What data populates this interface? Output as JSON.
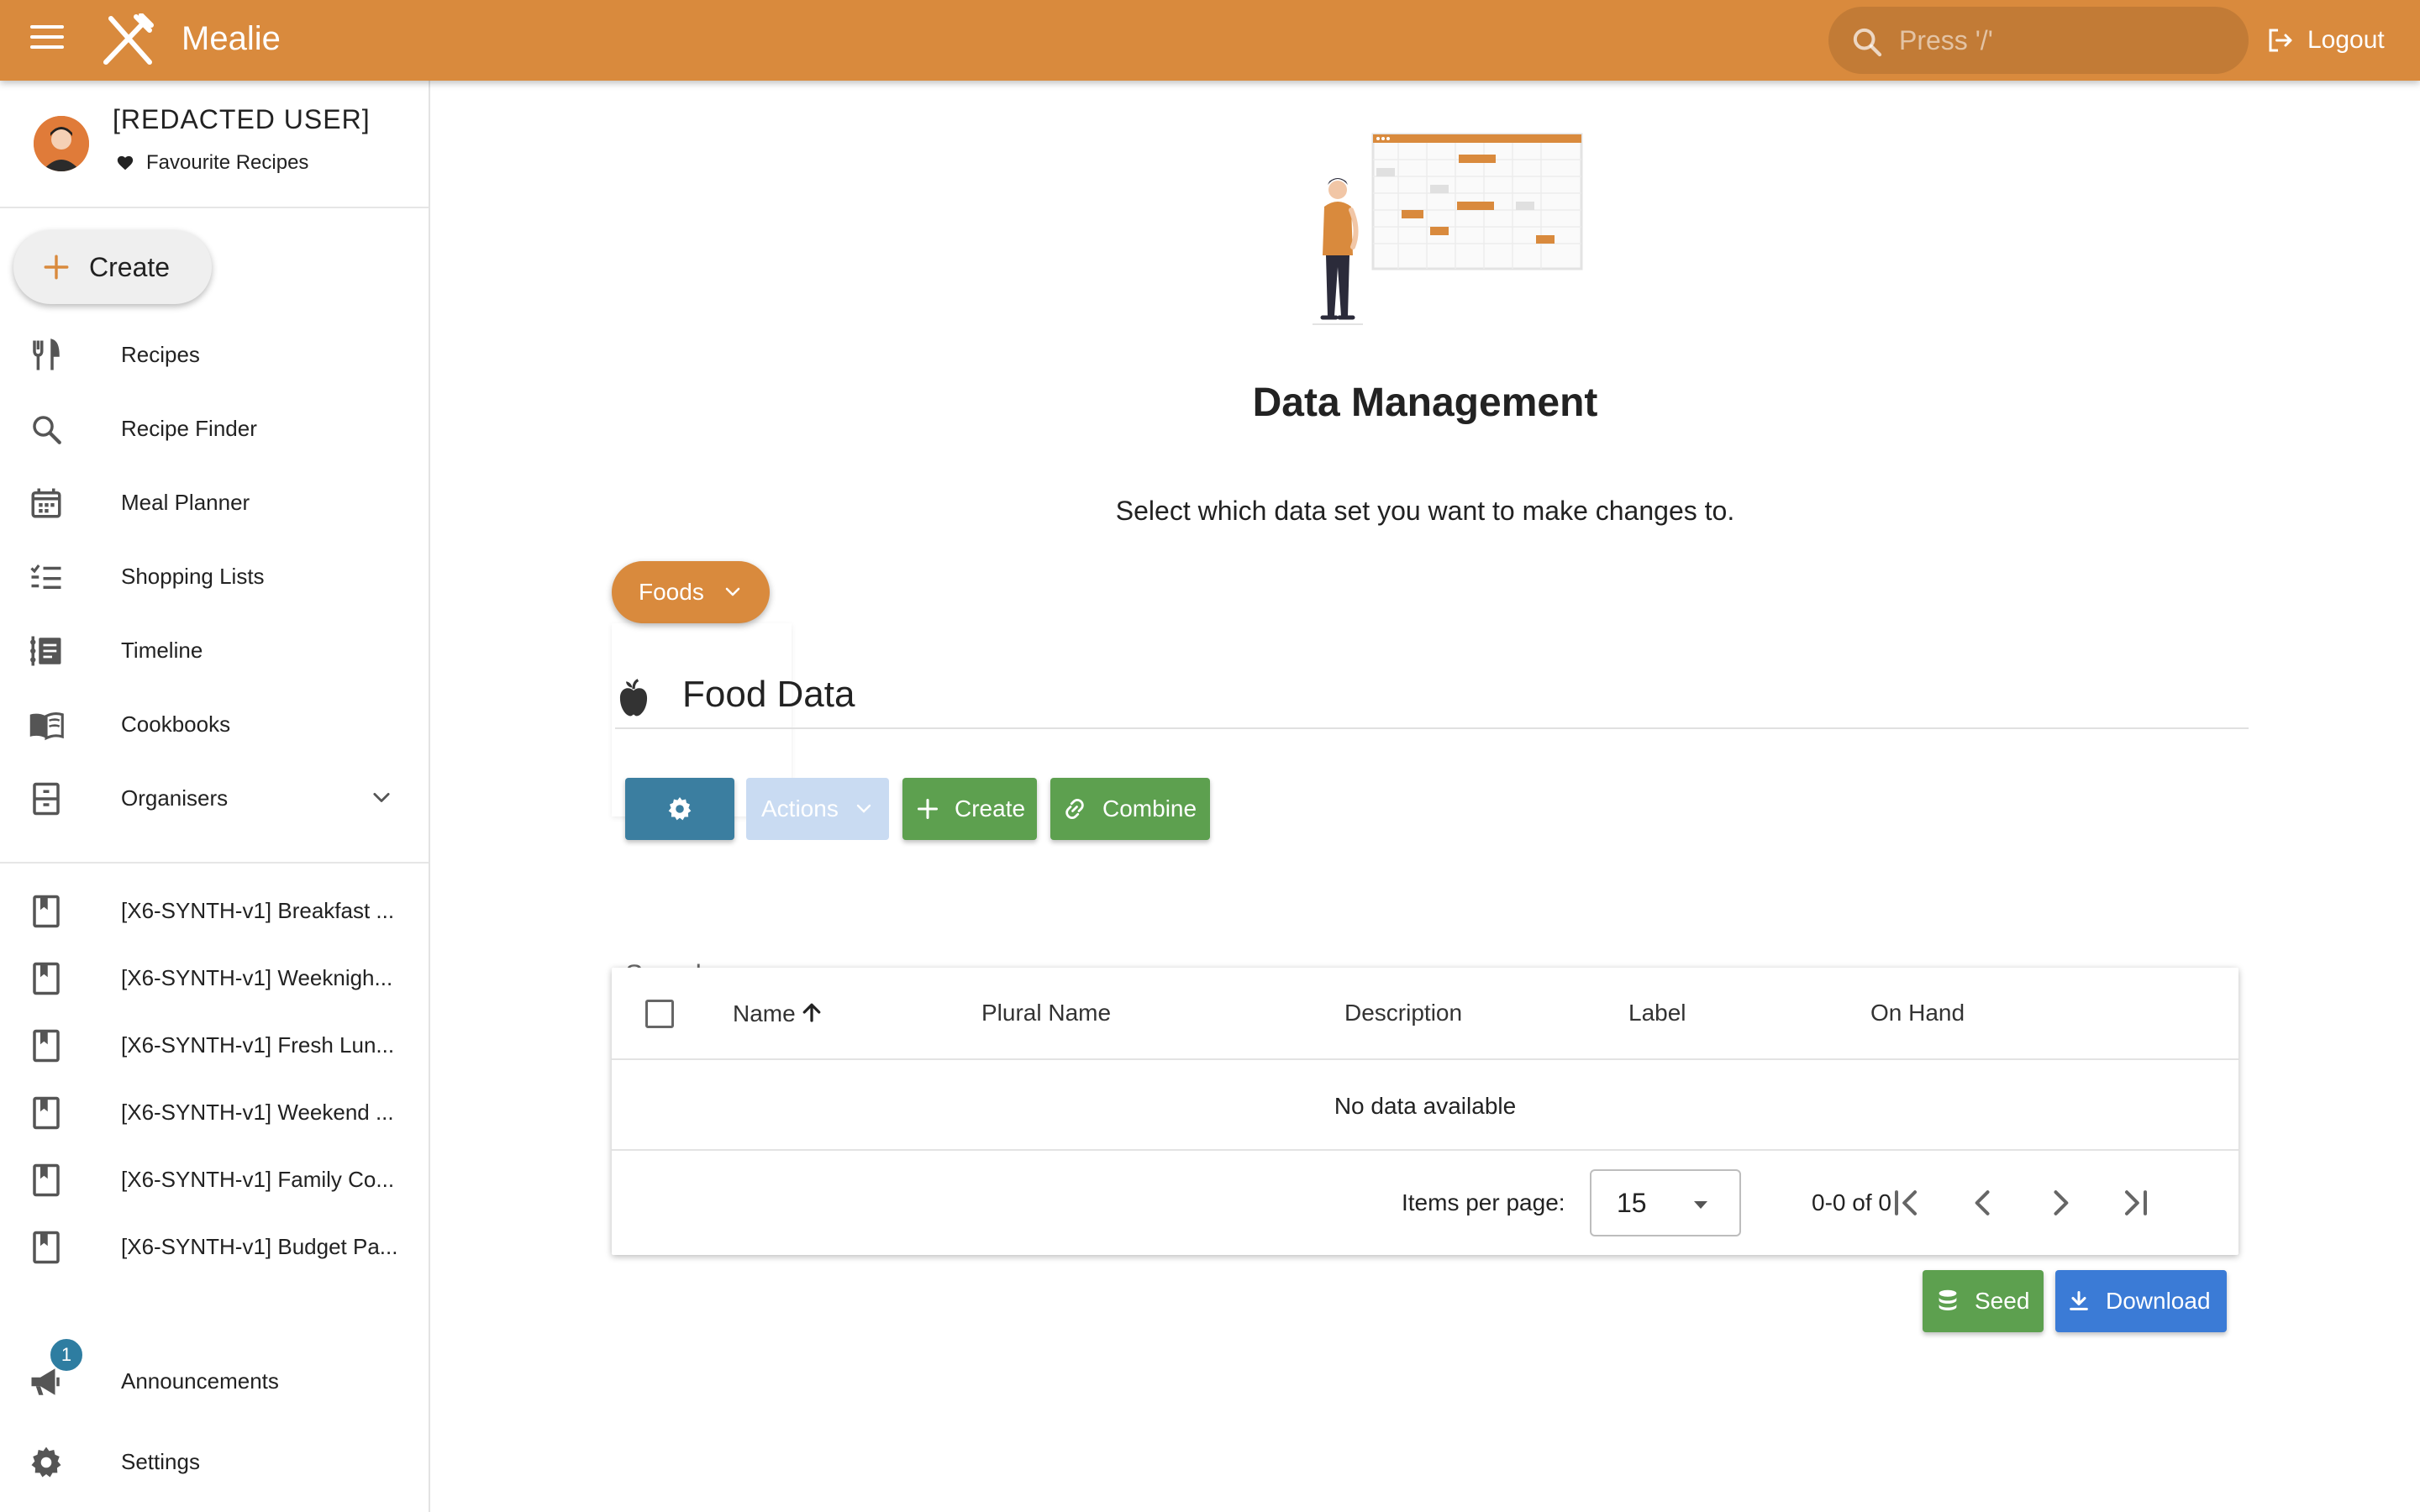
{
  "app": {
    "brand": "Mealie",
    "search_placeholder": "Press '/'",
    "logout_label": "Logout",
    "accent_color": "#D98A3D"
  },
  "user": {
    "name": "[REDACTED USER]",
    "favourites_label": "Favourite Recipes"
  },
  "sidebar": {
    "create_label": "Create",
    "nav": [
      {
        "label": "Recipes",
        "icon": "fork-knife-icon"
      },
      {
        "label": "Recipe Finder",
        "icon": "search-icon"
      },
      {
        "label": "Meal Planner",
        "icon": "calendar-icon"
      },
      {
        "label": "Shopping Lists",
        "icon": "checklist-icon"
      },
      {
        "label": "Timeline",
        "icon": "timeline-icon"
      },
      {
        "label": "Cookbooks",
        "icon": "book-icon"
      },
      {
        "label": "Organisers",
        "icon": "file-cabinet-icon"
      }
    ],
    "cookbooks": [
      "[X6-SYNTH-v1] Breakfast ...",
      "[X6-SYNTH-v1] Weeknigh...",
      "[X6-SYNTH-v1] Fresh Lun...",
      "[X6-SYNTH-v1] Weekend ...",
      "[X6-SYNTH-v1] Family Co...",
      "[X6-SYNTH-v1] Budget Pa..."
    ],
    "announcements_label": "Announcements",
    "announcements_count": "1",
    "settings_label": "Settings"
  },
  "main": {
    "title": "Data Management",
    "subtitle": "Select which data set you want to make changes to.",
    "dataset_label": "Foods",
    "section_title": "Food Data",
    "toolbar": {
      "actions_label": "Actions",
      "create_label": "Create",
      "combine_label": "Combine"
    },
    "search_placeholder": "Search",
    "table": {
      "columns": [
        "Name",
        "Plural Name",
        "Description",
        "Label",
        "On Hand"
      ],
      "empty_text": "No data available",
      "items_per_page_label": "Items per page:",
      "items_per_page": "15",
      "range_text": "0-0 of 0"
    },
    "seed_label": "Seed",
    "download_label": "Download"
  }
}
